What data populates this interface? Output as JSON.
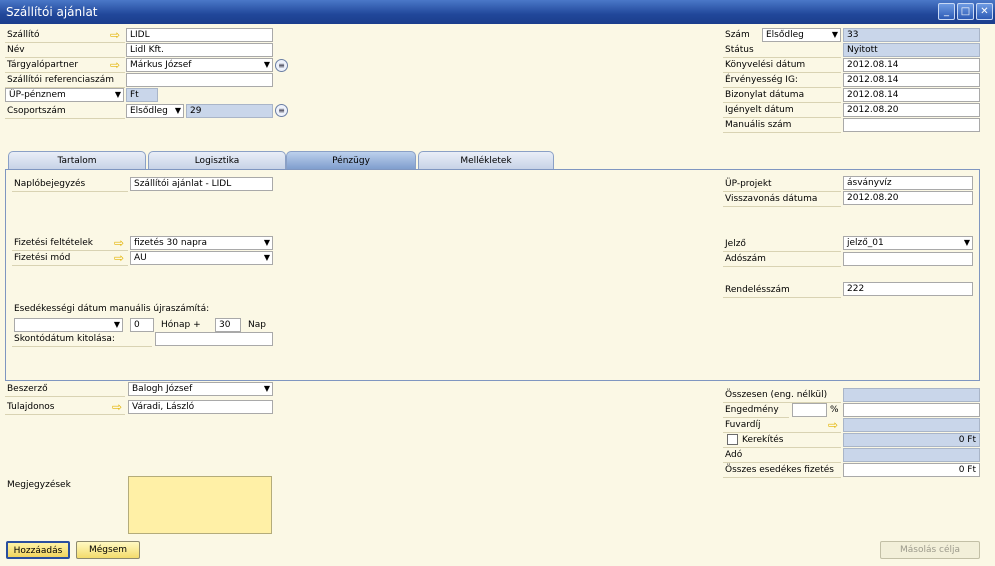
{
  "window": {
    "title": "Szállítói ajánlat"
  },
  "header_left": {
    "supplier_label": "Szállító",
    "supplier_value": "LIDL",
    "name_label": "Név",
    "name_value": "Lidl Kft.",
    "contact_label": "Tárgyalópartner",
    "contact_value": "Márkus József",
    "ref_label": "Szállítói referenciaszám",
    "ref_value": "",
    "currency_select": "ÜP-pénznem",
    "currency_value": "Ft",
    "group_label": "Csoportszám",
    "group_series": "Elsődleg",
    "group_value": "29"
  },
  "header_right": {
    "number_label": "Szám",
    "number_series": "Elsődleg",
    "number_value": "33",
    "status_label": "Státus",
    "status_value": "Nyitott",
    "posting_label": "Könyvelési dátum",
    "posting_value": "2012.08.14",
    "valid_label": "Érvényesség IG:",
    "valid_value": "2012.08.14",
    "doc_date_label": "Bizonylat dátuma",
    "doc_date_value": "2012.08.14",
    "req_date_label": "Igényelt dátum",
    "req_date_value": "2012.08.20",
    "manual_label": "Manuális szám",
    "manual_value": ""
  },
  "tabs": [
    {
      "label": "Tartalom"
    },
    {
      "label": "Logisztika"
    },
    {
      "label": "Pénzügy"
    },
    {
      "label": "Mellékletek"
    }
  ],
  "finance": {
    "journal_label": "Naplóbejegyzés",
    "journal_value": "Szállítói ajánlat - LIDL",
    "payterms_label": "Fizetési feltételek",
    "payterms_value": "fizetés 30 napra",
    "paymethod_label": "Fizetési mód",
    "paymethod_value": "AU",
    "duedate_label": "Esedékességi dátum manuális újraszámítá:",
    "duedate_select": "",
    "month_value": "0",
    "month_label": "Hónap +",
    "day_value": "30",
    "day_label": "Nap",
    "discount_label": "Skontódátum kitolása:",
    "discount_value": "",
    "project_label": "ÜP-projekt",
    "project_value": "ásványvíz",
    "cancel_date_label": "Visszavonás dátuma",
    "cancel_date_value": "2012.08.20",
    "indicator_label": "Jelző",
    "indicator_value": "jelző_01",
    "tax_no_label": "Adószám",
    "tax_no_value": "",
    "order_no_label": "Rendelésszám",
    "order_no_value": "222"
  },
  "footer_left": {
    "buyer_label": "Beszerző",
    "buyer_value": "Balogh József",
    "owner_label": "Tulajdonos",
    "owner_value": "Váradi, László",
    "remarks_label": "Megjegyzések"
  },
  "totals": {
    "total_label": "Összesen (eng. nélkül)",
    "total_value": "",
    "discount_label": "Engedmény",
    "discount_pct": "",
    "pct_sign": "%",
    "discount_value": "",
    "freight_label": "Fuvardíj",
    "freight_value": "",
    "rounding_label": "Kerekítés",
    "rounding_value": "0 Ft",
    "tax_label": "Adó",
    "tax_value": "",
    "due_label": "Összes esedékes fizetés",
    "due_value": "0 Ft"
  },
  "buttons": {
    "add": "Hozzáadás",
    "cancel": "Mégsem",
    "copy_to": "Másolás célja"
  }
}
